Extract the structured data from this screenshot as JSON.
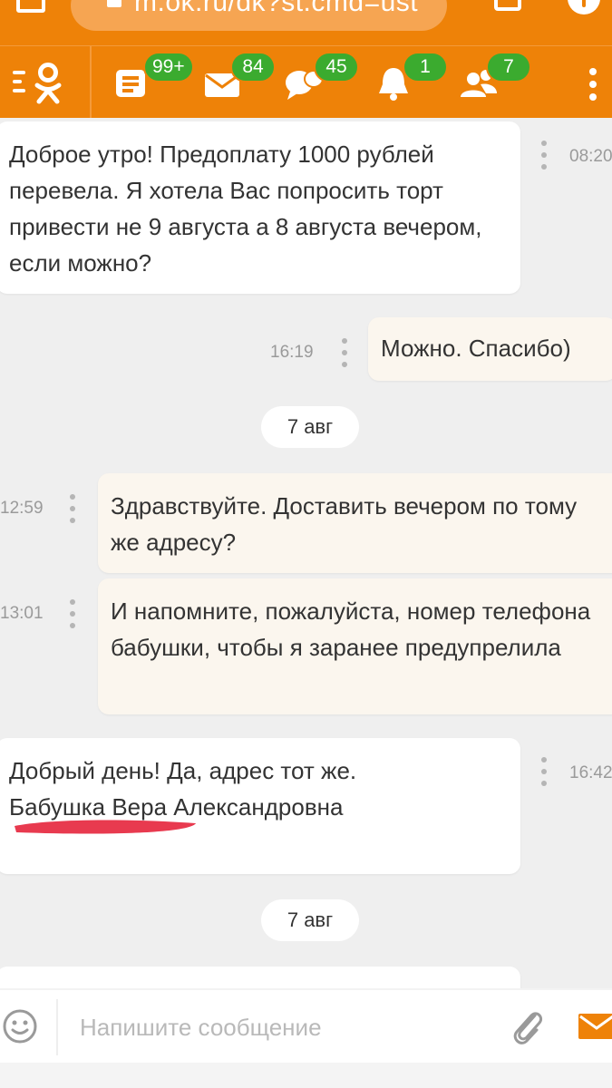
{
  "browser": {
    "url": "m.ok.ru/dk?st.cmd=ust"
  },
  "header": {
    "badges": {
      "feed": "99+",
      "messages": "84",
      "discussions": "45",
      "notifications": "1",
      "guests": "7"
    }
  },
  "messages": [
    {
      "id": "m1",
      "direction": "in",
      "text": "Доброе утро! Предоплату 1000 рублей перевела. Я хотела Вас попросить торт привести не 9 августа а 8 августа вечером, если можно?",
      "time": "08:20"
    },
    {
      "id": "m2",
      "direction": "out",
      "text": "Можно. Спасибо)",
      "time": "16:19"
    },
    {
      "id": "d1",
      "type": "date",
      "text": "7 авг"
    },
    {
      "id": "m3",
      "direction": "out",
      "text": "Здравствуйте.  Доставить вечером по тому же адресу?",
      "time": "12:59"
    },
    {
      "id": "m4",
      "direction": "out",
      "text": "И напомните, пожалуйста, номер телефона бабушки, чтобы я заранее предупрелила",
      "time": "13:01"
    },
    {
      "id": "m5",
      "direction": "in",
      "text_line1": "Добрый день! Да, адрес тот же.",
      "text_line2": "Бабушка Вера Александровна",
      "time": "16:42"
    },
    {
      "id": "d2",
      "type": "date",
      "text": "7 авг"
    }
  ],
  "composer": {
    "placeholder": "Напишите сообщение"
  },
  "colors": {
    "brand": "#ee8208",
    "badge": "#3bab2f",
    "outgoing_bubble": "#fbf6ee",
    "redaction": "#e83a4f"
  }
}
